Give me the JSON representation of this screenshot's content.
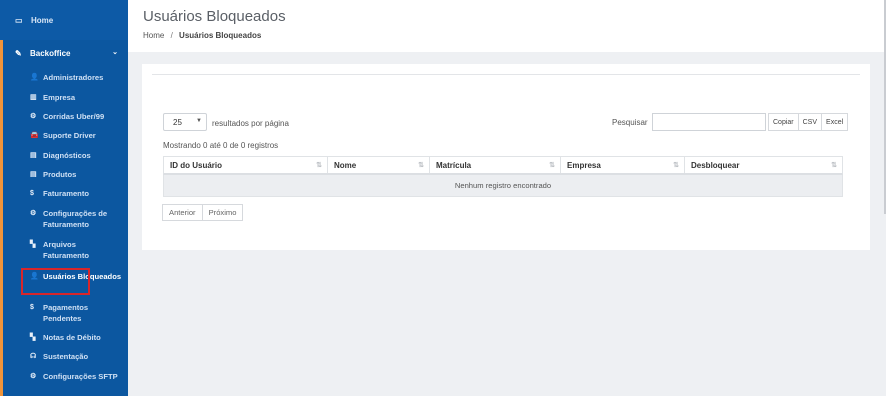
{
  "sidebar": {
    "home": {
      "label": "Home",
      "icon": "laptop-icon"
    },
    "backoffice": {
      "label": "Backoffice",
      "icon": "edit-icon"
    },
    "items": [
      {
        "label": "Administradores",
        "icon": "user-icon",
        "glyph": "👤"
      },
      {
        "label": "Empresa",
        "icon": "building-icon",
        "glyph": "▥"
      },
      {
        "label": "Corridas Uber/99",
        "icon": "cogs-icon",
        "glyph": "⚙"
      },
      {
        "label": "Suporte Driver",
        "icon": "car-icon",
        "glyph": "🚘"
      },
      {
        "label": "Diagnósticos",
        "icon": "document-icon",
        "glyph": "▤"
      },
      {
        "label": "Produtos",
        "icon": "box-icon",
        "glyph": "▤"
      },
      {
        "label": "Faturamento",
        "icon": "dollar-icon",
        "glyph": "$"
      },
      {
        "label": "Configurações de Faturamento",
        "icon": "cogs-icon",
        "glyph": "⚙"
      },
      {
        "label": "Arquivos Faturamento",
        "icon": "files-icon",
        "glyph": "▚"
      },
      {
        "label": "Usuários Bloqueados",
        "icon": "user-icon",
        "glyph": "👤",
        "active": true
      },
      {
        "label": "Pagamentos Pendentes",
        "icon": "dollar-icon",
        "glyph": "$"
      },
      {
        "label": "Notas de Débito",
        "icon": "files-icon",
        "glyph": "▚"
      },
      {
        "label": "Sustentação",
        "icon": "headset-icon",
        "glyph": "☊"
      },
      {
        "label": "Configurações SFTP",
        "icon": "cogs-icon",
        "glyph": "⚙"
      }
    ]
  },
  "header": {
    "title": "Usuários Bloqueados",
    "breadcrumb": {
      "home": "Home",
      "separator": "/",
      "current": "Usuários Bloqueados"
    }
  },
  "table_controls": {
    "page_length": "25",
    "page_length_suffix": "resultados por página",
    "search_label": "Pesquisar",
    "search_value": "",
    "buttons": {
      "copy": "Copiar",
      "csv": "CSV",
      "excel": "Excel"
    },
    "info": "Mostrando 0 até 0 de 0 registros"
  },
  "table": {
    "columns": [
      "ID do Usuário",
      "Nome",
      "Matrícula",
      "Empresa",
      "Desbloquear"
    ],
    "empty_message": "Nenhum registro encontrado"
  },
  "pagination": {
    "previous": "Anterior",
    "next": "Próximo"
  },
  "colors": {
    "sidebar": "#0d5aa6",
    "accent": "#f0943a",
    "highlight": "#d9262b"
  }
}
